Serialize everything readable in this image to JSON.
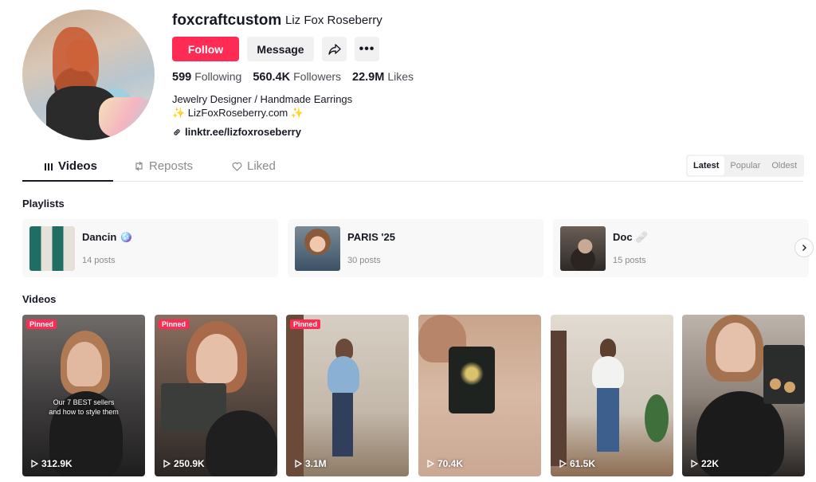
{
  "profile": {
    "username": "foxcraftcustom",
    "nickname": "Liz Fox Roseberry",
    "follow_label": "Follow",
    "message_label": "Message",
    "stats": [
      {
        "value": "599",
        "label": "Following"
      },
      {
        "value": "560.4K",
        "label": "Followers"
      },
      {
        "value": "22.9M",
        "label": "Likes"
      }
    ],
    "bio_line1": "Jewelry Designer / Handmade Earrings",
    "bio_line2": "✨ LizFoxRoseberry.com ✨",
    "link": "linktr.ee/lizfoxroseberry"
  },
  "tabs": [
    {
      "label": "Videos",
      "icon": "grid-icon",
      "active": true
    },
    {
      "label": "Reposts",
      "icon": "repost-icon",
      "active": false
    },
    {
      "label": "Liked",
      "icon": "heart-icon",
      "active": false
    }
  ],
  "sort": [
    "Latest",
    "Popular",
    "Oldest"
  ],
  "playlists_title": "Playlists",
  "playlists": [
    {
      "title": "Dancin",
      "emoji": "🪩",
      "count": "14 posts"
    },
    {
      "title": "PARIS '25",
      "emoji": "",
      "count": "30 posts"
    },
    {
      "title": "Doc",
      "emoji": "🩹",
      "count": "15 posts"
    }
  ],
  "videos_title": "Videos",
  "pinned_label": "Pinned",
  "videos": [
    {
      "views": "312.9K",
      "pinned": true,
      "caption": "Our 7 BEST sellers\nand how to style them"
    },
    {
      "views": "250.9K",
      "pinned": true,
      "caption": ""
    },
    {
      "views": "3.1M",
      "pinned": true,
      "caption": ""
    },
    {
      "views": "70.4K",
      "pinned": false,
      "caption": ""
    },
    {
      "views": "61.5K",
      "pinned": false,
      "caption": ""
    },
    {
      "views": "22K",
      "pinned": false,
      "caption": ""
    }
  ],
  "colors": {
    "accent": "#fe2c55",
    "text": "#161823",
    "muted": "#8a8b91"
  }
}
